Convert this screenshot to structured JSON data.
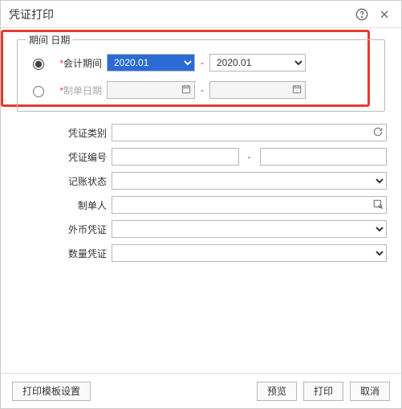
{
  "dialog": {
    "title": "凭证打印"
  },
  "group": {
    "legend": "期间 日期",
    "period_label": "会计期间",
    "period_from": "2020.01",
    "period_to": "2020.01",
    "date_label": "制单日期",
    "date_from": "",
    "date_to": ""
  },
  "fields": {
    "voucher_type": {
      "label": "凭证类别",
      "value": ""
    },
    "voucher_no": {
      "label": "凭证编号",
      "from": "",
      "to": ""
    },
    "post_status": {
      "label": "记账状态",
      "value": ""
    },
    "maker": {
      "label": "制单人",
      "value": ""
    },
    "foreign": {
      "label": "外币凭证",
      "value": ""
    },
    "qty": {
      "label": "数量凭证",
      "value": ""
    }
  },
  "footer": {
    "template": "打印模板设置",
    "preview": "预览",
    "print": "打印",
    "cancel": "取消"
  }
}
